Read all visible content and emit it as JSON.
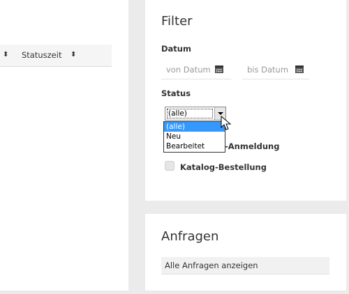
{
  "table": {
    "sort_glyph": "⬍",
    "status_time_header": "Statuszeit"
  },
  "filter": {
    "title": "Filter",
    "date_label": "Datum",
    "from_placeholder": "von Datum",
    "to_placeholder": "bis Datum",
    "status_label": "Status",
    "status_selected": "(alle)",
    "status_options": [
      "(alle)",
      "Neu",
      "Bearbeitet"
    ],
    "checkbox_1_label": "-Anmeldung",
    "checkbox_2_label": "Katalog-Bestellung"
  },
  "anfragen": {
    "title": "Anfragen",
    "show_all_label": "Alle Anfragen anzeigen"
  }
}
